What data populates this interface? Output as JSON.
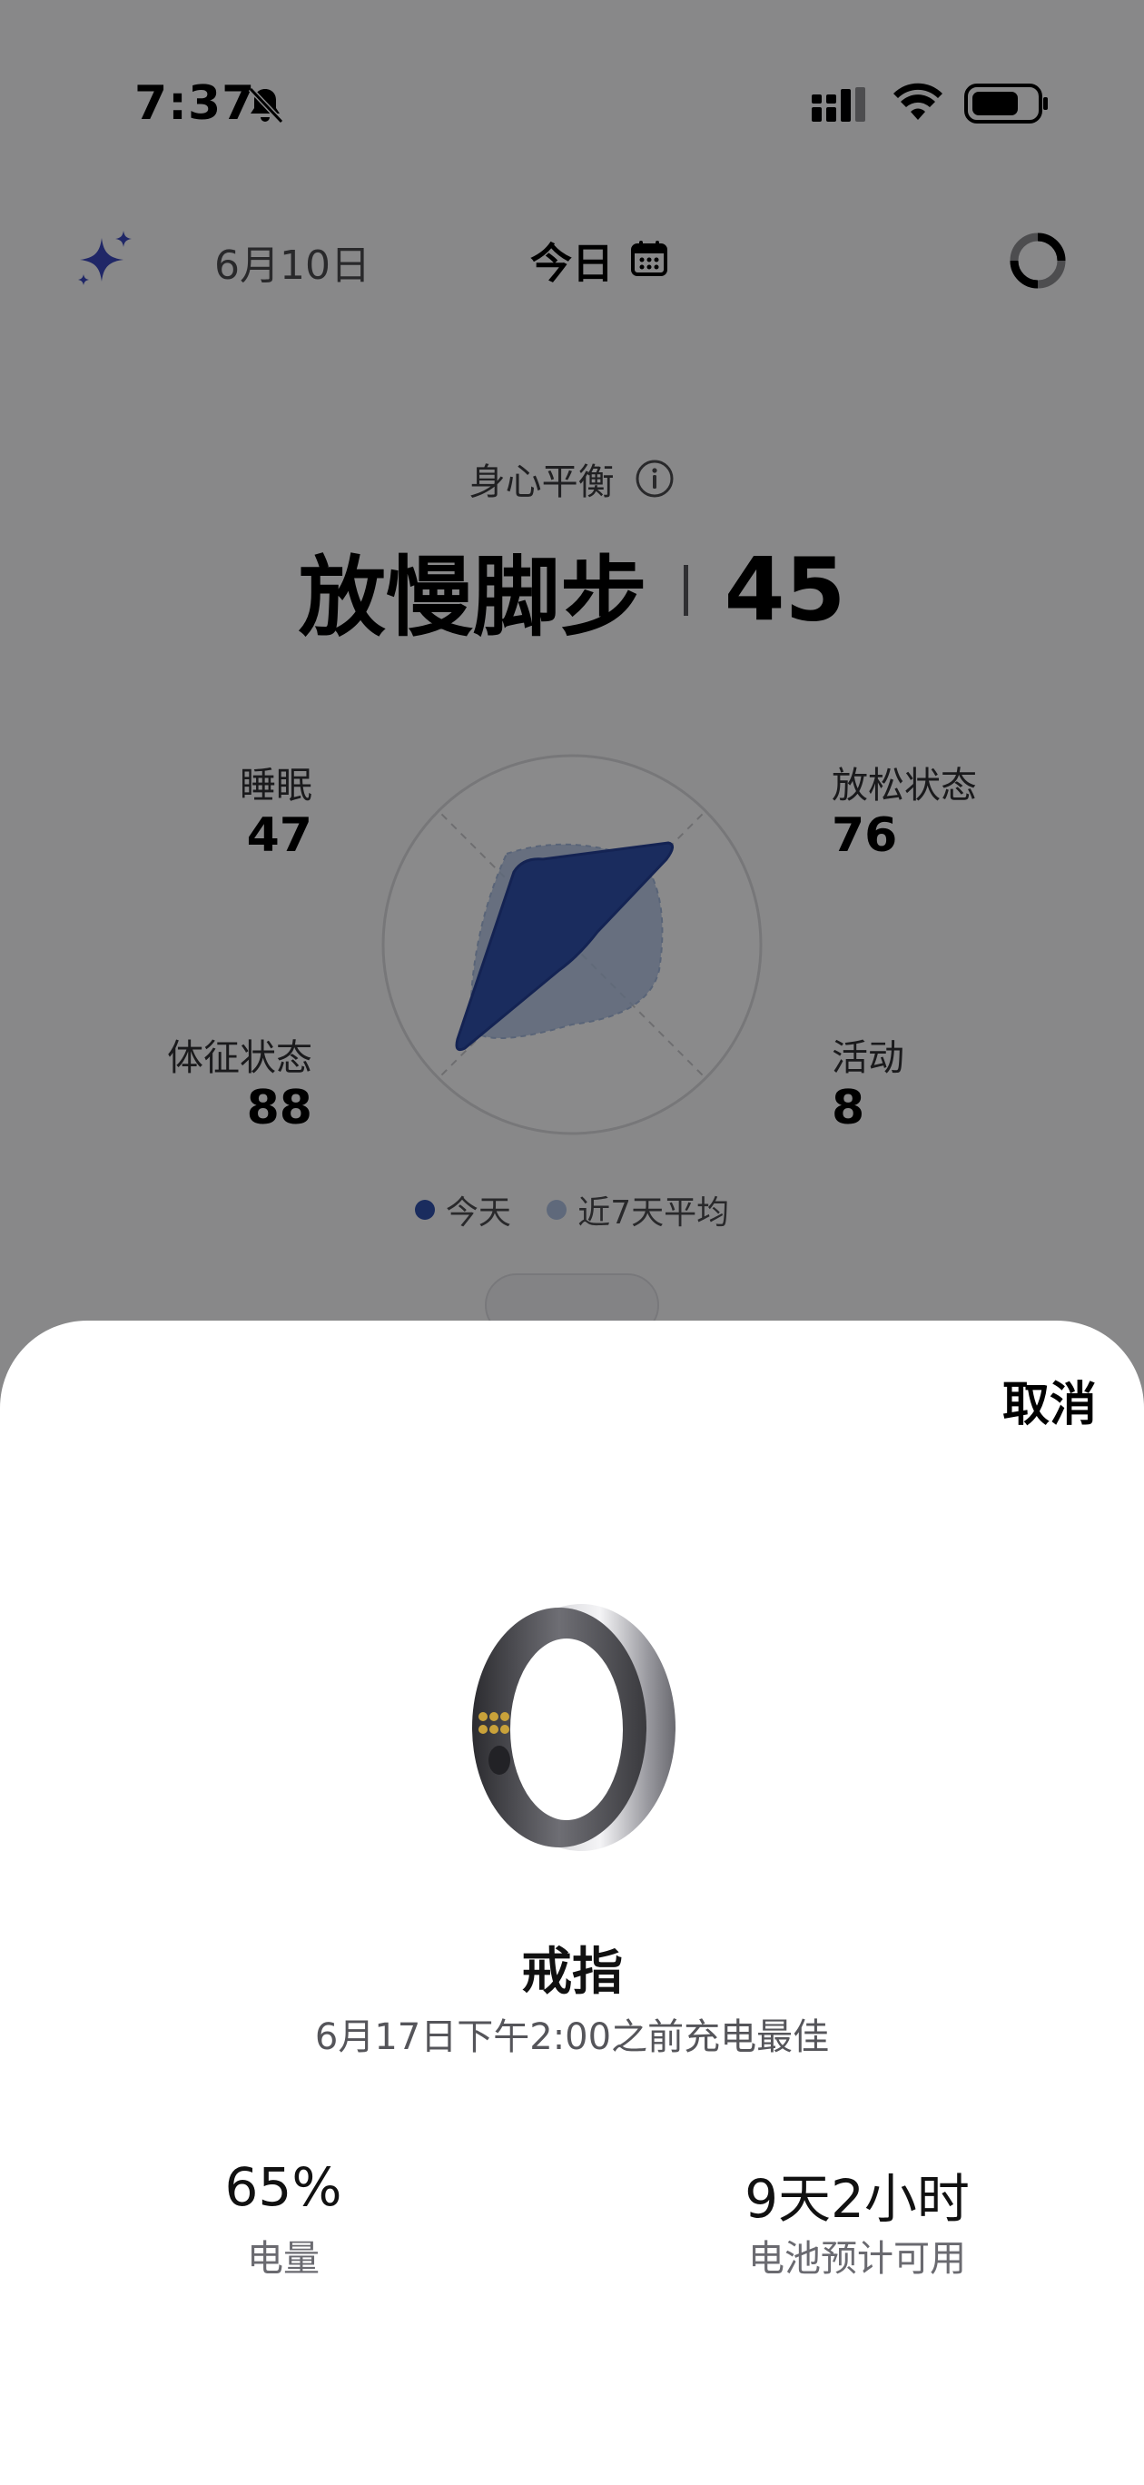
{
  "status_bar": {
    "time": "7:37",
    "icons": [
      "bell-slash-icon",
      "signal-icon",
      "wifi-icon",
      "battery-icon"
    ]
  },
  "header": {
    "prev_date": "6月10日",
    "current_label": "今日",
    "icons": [
      "sparkle-icon",
      "calendar-icon",
      "sync-icon"
    ]
  },
  "score": {
    "caption": "身心平衡",
    "status": "放慢脚步",
    "value": "45"
  },
  "dimensions": {
    "sleep": {
      "label": "睡眠",
      "value": "47"
    },
    "relax": {
      "label": "放松状态",
      "value": "76"
    },
    "vitals": {
      "label": "体征状态",
      "value": "88"
    },
    "activity": {
      "label": "活动",
      "value": "8"
    }
  },
  "legend": {
    "today": "今天",
    "avg7": "近7天平均"
  },
  "colors": {
    "today": "#2f4fa8",
    "avg7": "#a9bcdc",
    "accent": "#3a47b8"
  },
  "sheet": {
    "cancel_label": "取消",
    "device_name": "戒指",
    "charge_tip": "6月17日下午2:00之前充电最佳",
    "battery_value": "65%",
    "battery_label": "电量",
    "remaining_value": "9天2小时",
    "remaining_label": "电池预计可用"
  }
}
